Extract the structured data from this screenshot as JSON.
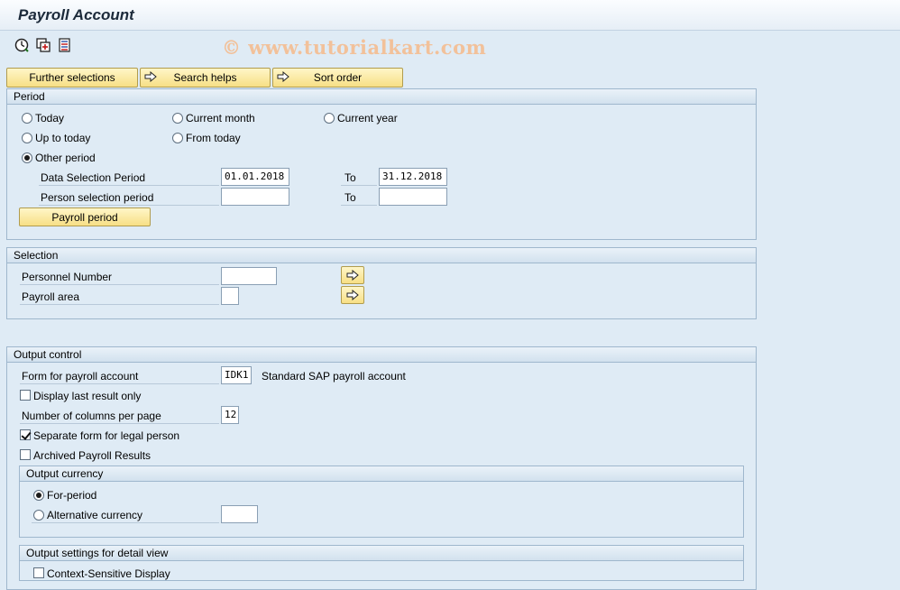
{
  "window": {
    "title": "Payroll Account"
  },
  "watermark": "© www.tutorialkart.com",
  "toolbar": {
    "icons": [
      "execute-icon",
      "variant-icon",
      "selection-options-icon"
    ]
  },
  "top_buttons": {
    "further_selections": "Further selections",
    "search_helps": "Search helps",
    "sort_order": "Sort order"
  },
  "period": {
    "header": "Period",
    "today": "Today",
    "current_month": "Current month",
    "current_year": "Current year",
    "up_to_today": "Up to today",
    "from_today": "From today",
    "other_period": "Other period",
    "selected": "other_period",
    "data_selection_label": "Data Selection Period",
    "data_selection_from": "01.01.2018",
    "to_label": "To",
    "data_selection_to": "31.12.2018",
    "person_selection_label": "Person selection period",
    "person_selection_from": "",
    "person_selection_to": "",
    "payroll_period_button": "Payroll period"
  },
  "selection": {
    "header": "Selection",
    "personnel_number_label": "Personnel Number",
    "personnel_number": "",
    "payroll_area_label": "Payroll area",
    "payroll_area": ""
  },
  "output_control": {
    "header": "Output control",
    "form_label": "Form for payroll account",
    "form_value": "IDK1",
    "form_description": "Standard SAP payroll account",
    "display_last_result": "Display last result only",
    "display_last_result_checked": false,
    "columns_label": "Number of columns per page",
    "columns_value": "12",
    "separate_form": "Separate form for legal person",
    "separate_form_checked": true,
    "archived_results": "Archived Payroll Results",
    "archived_results_checked": false
  },
  "output_currency": {
    "header": "Output currency",
    "for_period": "For-period",
    "alternative_currency": "Alternative currency",
    "selected": "for_period",
    "alternative_value": ""
  },
  "output_settings": {
    "header": "Output settings for detail view",
    "context_sensitive": "Context-Sensitive Display",
    "context_sensitive_checked": false
  }
}
